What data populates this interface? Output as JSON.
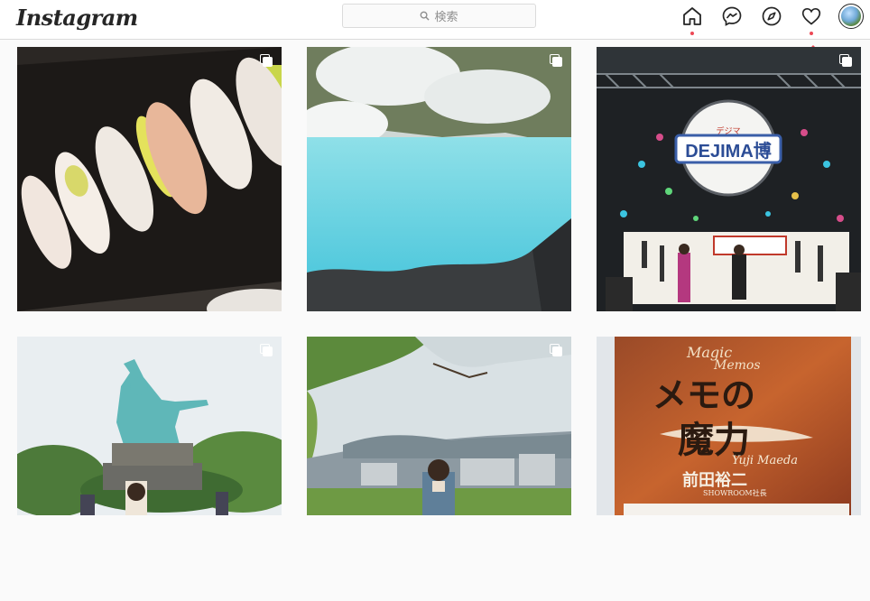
{
  "header": {
    "logo": "Instagram",
    "search_placeholder": "検索",
    "icons": [
      "home-icon",
      "messenger-icon",
      "explore-icon",
      "activity-heart-icon",
      "profile-avatar"
    ],
    "notification_count": "1",
    "accent_color": "#ed4956"
  },
  "posts": [
    {
      "id": 1,
      "multi": true,
      "icon": "carousel-icon"
    },
    {
      "id": 2,
      "multi": true,
      "icon": "carousel-icon"
    },
    {
      "id": 3,
      "multi": true,
      "icon": "carousel-icon",
      "sign_text": "DEJIMA博",
      "sign_ruby": "デジマ"
    },
    {
      "id": 4,
      "multi": true,
      "icon": "carousel-icon"
    },
    {
      "id": 5,
      "multi": true,
      "icon": "carousel-icon"
    },
    {
      "id": 6,
      "multi": false,
      "book": {
        "script_line1": "Magic",
        "script_line2": "Memos",
        "title_line1": "メモの",
        "title_line2": "魔力",
        "author_script": "Yuji Maeda",
        "author": "前田裕二",
        "publisher": "SHOWROOM社長"
      }
    }
  ]
}
